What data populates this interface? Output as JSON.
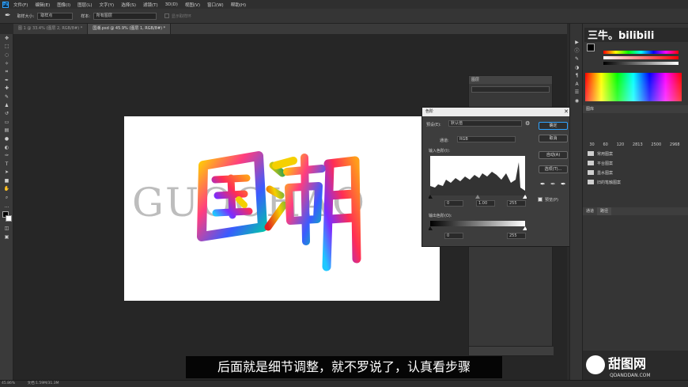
{
  "menu": {
    "items": [
      "文件(F)",
      "编辑(E)",
      "图像(I)",
      "图层(L)",
      "文字(Y)",
      "选择(S)",
      "滤镜(T)",
      "3D(D)",
      "视图(V)",
      "窗口(W)",
      "帮助(H)"
    ]
  },
  "options": {
    "sample_size_label": "取样大小:",
    "sample_size_value": "取样点",
    "sample_label": "样本:",
    "sample_value": "所有图层",
    "show_ring": "显示取样环"
  },
  "tabs": [
    {
      "label": "图 1 @ 33.4% (图层 2, RGB/8#) *"
    },
    {
      "label": "国潮.psd @ 45.9% (图层 1, RGB/8#) *"
    }
  ],
  "canvas": {
    "bg_text": "GUOCHAO",
    "art_text": "国潮"
  },
  "levels": {
    "title": "色阶",
    "preset_label": "预设(E):",
    "preset_value": "默认值",
    "channel_label": "通道:",
    "channel_value": "RGB",
    "input_label": "输入色阶(I):",
    "input_values": [
      "0",
      "1.00",
      "255"
    ],
    "output_label": "输出色阶(O):",
    "output_values": [
      "0",
      "255"
    ],
    "buttons": {
      "ok": "确定",
      "cancel": "取消",
      "auto": "自动(A)",
      "options": "选项(T)..."
    },
    "preview_label": "预览(P)"
  },
  "layers_panel": {
    "title": "图层"
  },
  "right": {
    "library_title": "图库",
    "folders": [
      "常用图案",
      "平台图案",
      "墨水图案",
      "旧的笔触图案"
    ],
    "brush_sizes": [
      "30",
      "60",
      "120",
      "2813",
      "2500",
      "2968"
    ],
    "tabs": [
      "通道",
      "路径"
    ]
  },
  "status": {
    "zoom": "45.86%",
    "doc": "文档:1.59M/31.3M"
  },
  "subtitle": {
    "text": "后面就是细节调整，就不罗说了，认真看步骤"
  },
  "watermark": {
    "top": "三牛。bilibili",
    "bottom_cn": "甜图网",
    "bottom_en": "QDANDDAN.COM"
  },
  "colors": {
    "accent": "#2fa3ff",
    "subtitle_bg": "#000000"
  }
}
